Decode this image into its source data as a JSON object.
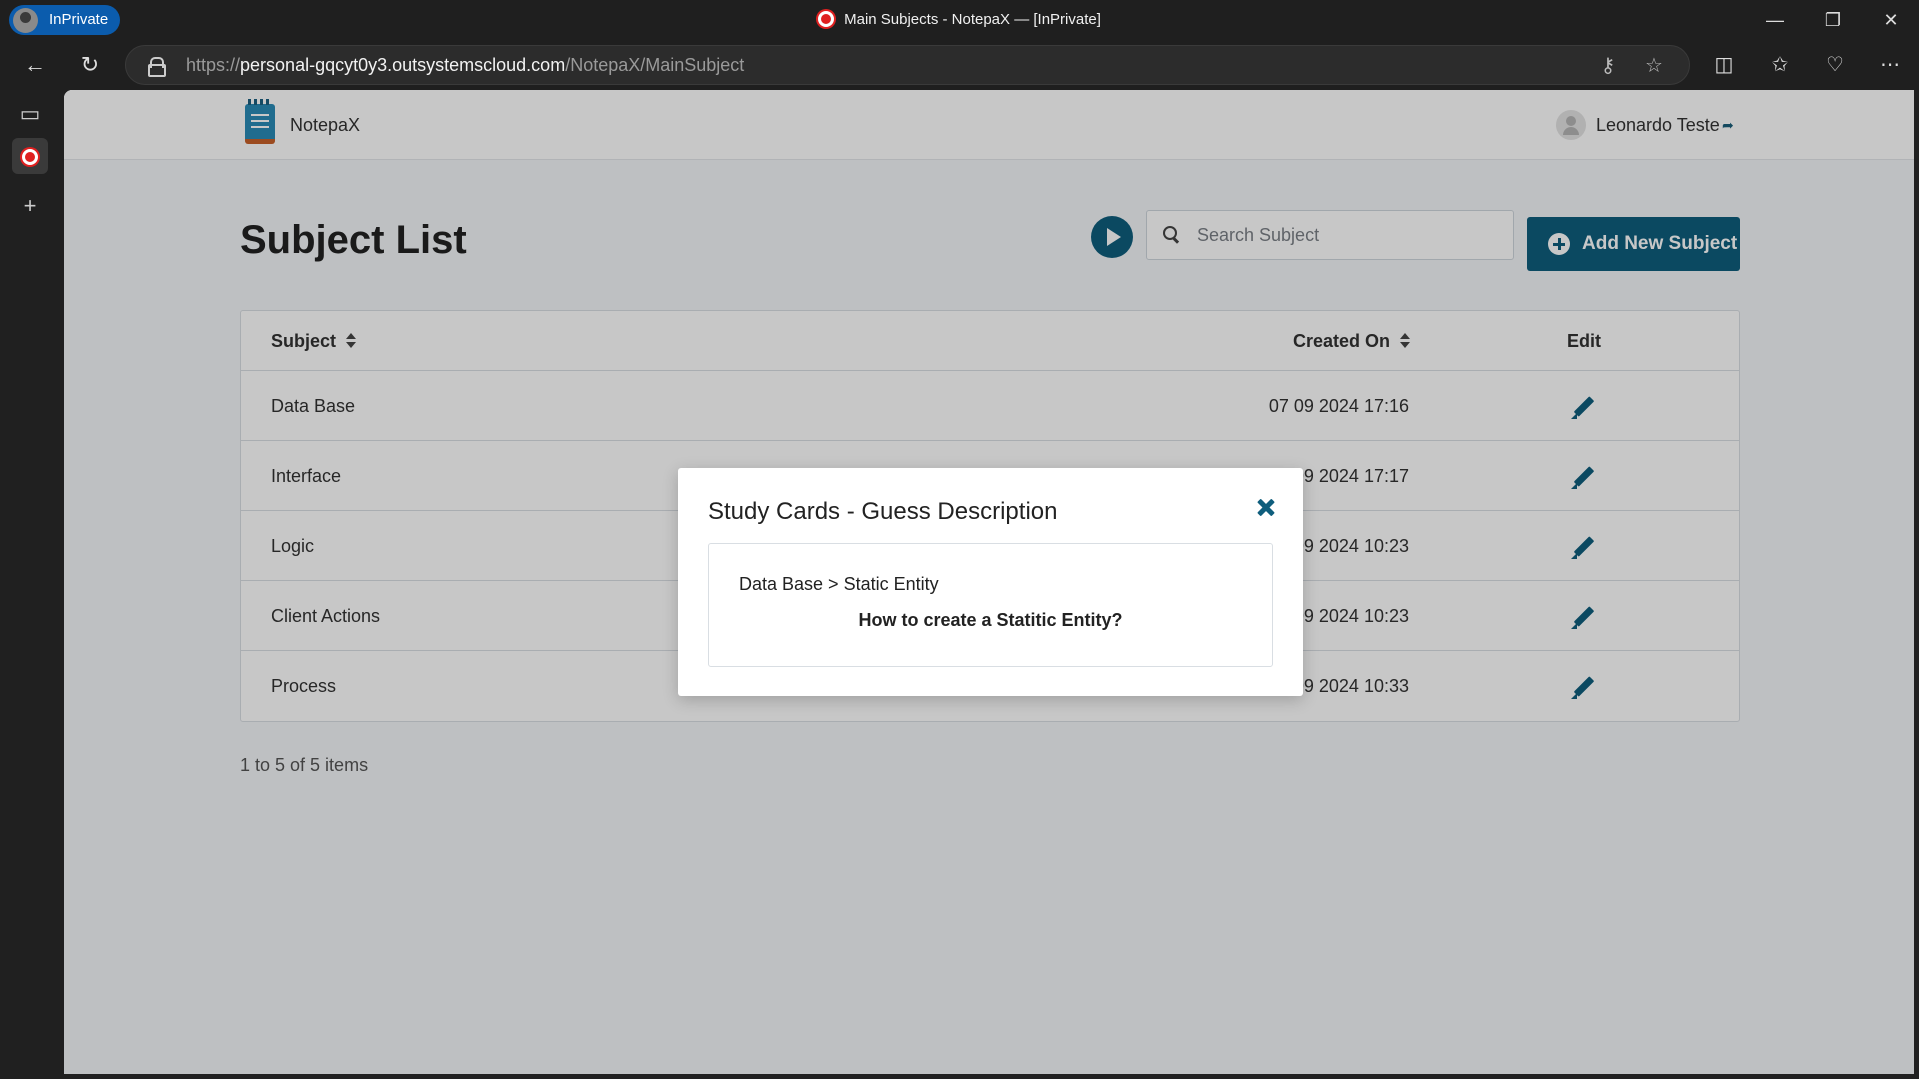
{
  "browser": {
    "inprivate_label": "InPrivate",
    "window_title": "Main Subjects - NotepaX — [InPrivate]",
    "url_prefix": "https://",
    "url_host": "personal-gqcyt0y3.outsystemscloud.com",
    "url_path": "/NotepaX/MainSubject"
  },
  "app": {
    "name": "NotepaX",
    "user_name": "Leonardo Teste"
  },
  "page": {
    "title": "Subject List",
    "search_placeholder": "Search Subject",
    "add_button_label": "Add New Subject"
  },
  "table": {
    "headers": {
      "subject": "Subject",
      "created_on": "Created On",
      "edit": "Edit"
    },
    "rows": [
      {
        "subject": "Data Base",
        "created_on": "07 09 2024 17:16"
      },
      {
        "subject": "Interface",
        "created_on": "09 2024 17:17"
      },
      {
        "subject": "Logic",
        "created_on": "09 2024 10:23"
      },
      {
        "subject": "Client Actions",
        "created_on": "09 2024 10:23"
      },
      {
        "subject": "Process",
        "created_on": "09 2024 10:33"
      }
    ],
    "pager_text": "1 to 5 of 5 items"
  },
  "modal": {
    "title": "Study Cards - Guess Description",
    "breadcrumb": "Data Base > Static Entity",
    "question": "How to create a Statitic Entity?"
  },
  "colors": {
    "primary": "#0f5e7d",
    "page_bg": "#f4f6f9"
  }
}
